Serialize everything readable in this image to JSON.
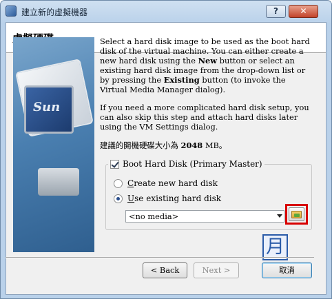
{
  "window": {
    "title": "建立新的虛擬機器",
    "help_label": "?",
    "close_label": "✕"
  },
  "header": {
    "title": "虛擬硬碟"
  },
  "side_image": {
    "logo_text": "Sun"
  },
  "description": {
    "p1_a": "Select a hard disk image to be used as the boot hard disk of the virtual machine. You can either create a new hard disk using the ",
    "p1_new": "New",
    "p1_b": " button or select an existing hard disk image from the drop-down list or by pressing the ",
    "p1_existing": "Existing",
    "p1_c": " button (to invoke the Virtual Media Manager dialog).",
    "p2": "If you need a more complicated hard disk setup, you can also skip this step and attach hard disks later using the VM Settings dialog.",
    "size_prefix": "建議的開機硬碟大小為 ",
    "size_value": "2048",
    "size_suffix": " MB。"
  },
  "boot_disk": {
    "label": "Boot Hard Disk (Primary Master)",
    "checked": true,
    "create_label": "Create new hard disk",
    "existing_label": "Use existing hard disk",
    "selected": "existing",
    "media_value": "<no media>"
  },
  "watermark": {
    "text": "月"
  },
  "buttons": {
    "back": "< Back",
    "next": "Next >",
    "cancel": "取消"
  },
  "colors": {
    "highlight_frame": "#d80000",
    "title_close": "#c2432a"
  }
}
